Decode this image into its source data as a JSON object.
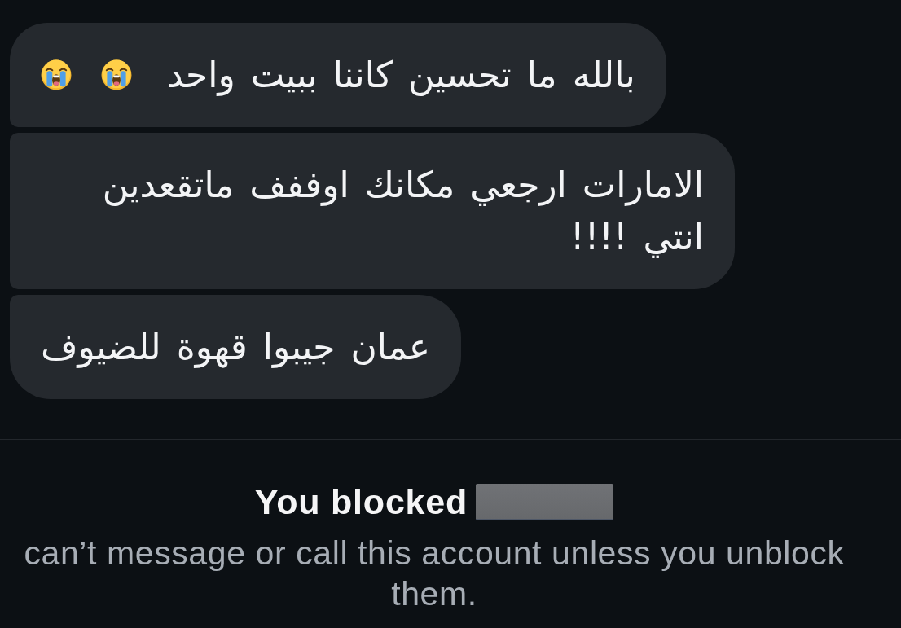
{
  "messages": [
    {
      "text": "بالله ما تحسين كاننا ببيت واحد",
      "emojis": [
        {
          "kind": "crying"
        },
        {
          "kind": "crying"
        }
      ]
    },
    {
      "text": "الامارات ارجعي مكانك اوففف ماتقعدين انتي !!!!"
    },
    {
      "text": "عمان جيبوا قهوة للضيوف"
    }
  ],
  "blocked_notice": {
    "title": "You blocked",
    "name_redacted": true,
    "message": "can’t message or call this account unless you unblock them."
  }
}
